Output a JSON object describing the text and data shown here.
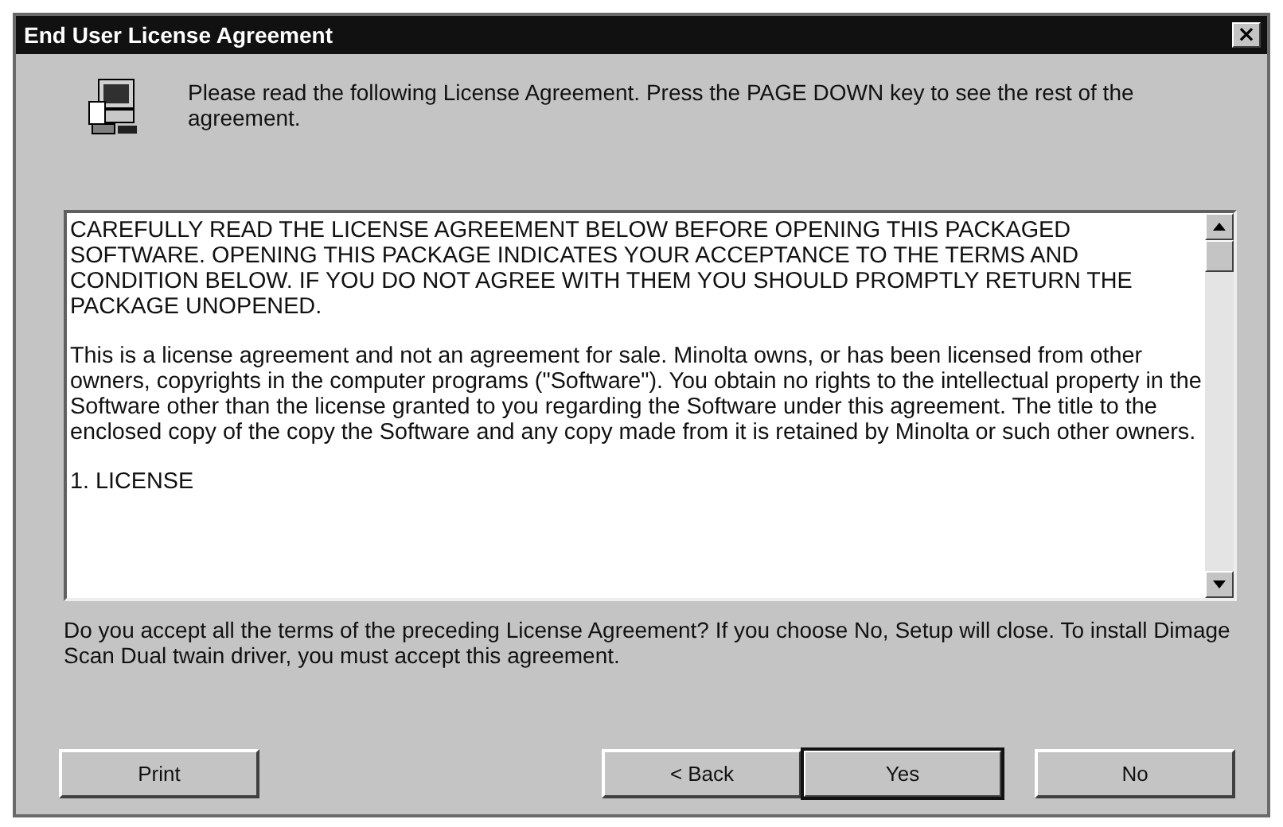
{
  "window": {
    "title": "End User License Agreement",
    "close_glyph": "×"
  },
  "instruction": "Please read the following License Agreement.  Press the PAGE DOWN key to see the rest of the agreement.",
  "license_text": {
    "paragraphs": [
      {
        "kind": "caps",
        "text": "CAREFULLY READ THE LICENSE AGREEMENT BELOW BEFORE OPENING THIS PACKAGED SOFTWARE. OPENING THIS PACKAGE INDICATES YOUR ACCEPTANCE TO THE TERMS AND CONDITION BELOW. IF YOU DO NOT AGREE WITH THEM YOU SHOULD PROMPTLY RETURN THE PACKAGE UNOPENED."
      },
      {
        "kind": "body",
        "text": "This is a license agreement and not an agreement for sale. Minolta owns, or has been licensed from other owners, copyrights in the computer programs (\"Software\"). You obtain no rights to the intellectual property in the Software other than the license granted to you regarding the Software under this agreement. The title to the enclosed copy of the copy the Software and any copy made from it is retained by Minolta or such other owners."
      },
      {
        "kind": "caps",
        "text": "1. LICENSE"
      }
    ]
  },
  "question": "Do you accept all the terms of the preceding License Agreement?  If you choose No, Setup will close. To install Dimage Scan Dual twain driver, you must accept this agreement.",
  "buttons_left": [
    {
      "label": "Print",
      "default": false
    }
  ],
  "buttons_right": [
    {
      "label": "< Back",
      "default": false
    },
    {
      "label": "Yes",
      "default": true
    },
    {
      "label": "No",
      "default": false
    }
  ]
}
